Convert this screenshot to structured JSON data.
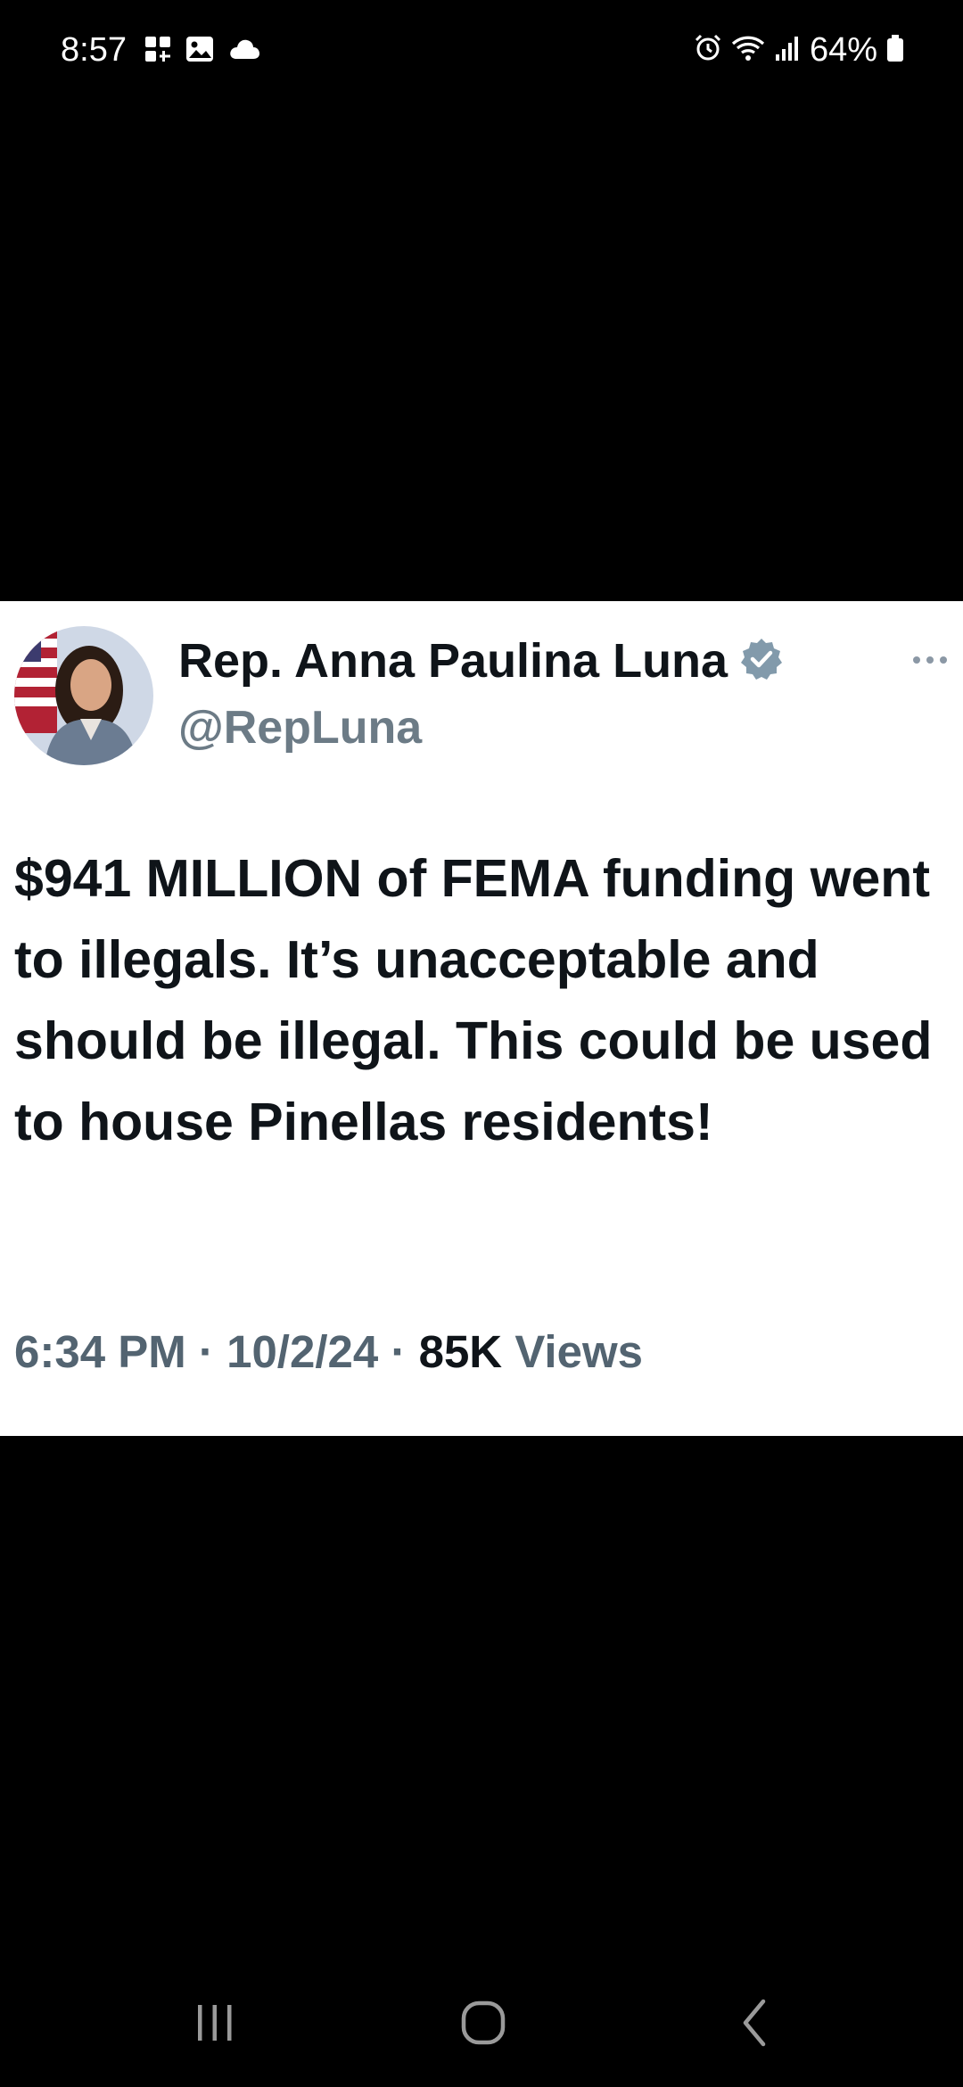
{
  "status_bar": {
    "time": "8:57",
    "battery_percent": "64%",
    "left_icons": [
      "grid-icon",
      "image-icon",
      "cloud-icon"
    ],
    "right_icons": [
      "alarm-icon",
      "wifi-icon",
      "signal-icon",
      "battery-icon"
    ]
  },
  "tweet": {
    "author_name": "Rep. Anna Paulina Luna",
    "handle": "@RepLuna",
    "verified": true,
    "text": "$941 MILLION of FEMA funding went to illegals. It’s unacceptable and should be illegal. This could be used to house Pinellas residents!",
    "time": "6:34 PM",
    "date": "10/2/24",
    "views_count": "85K",
    "views_label": "Views",
    "separator": "·"
  },
  "nav_bar": {
    "buttons": [
      "recent-apps",
      "home",
      "back"
    ]
  },
  "colors": {
    "background": "#000000",
    "card": "#ffffff",
    "text_primary": "#0f1419",
    "text_secondary": "#536471",
    "verified_badge": "#829aab"
  }
}
